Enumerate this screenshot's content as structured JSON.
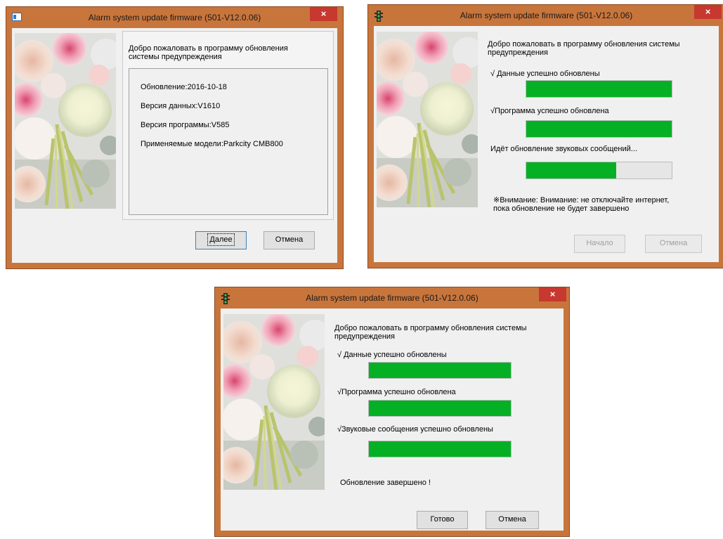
{
  "colors": {
    "progress": "#06b025",
    "titlebar": "#c8753c",
    "close": "#c7382f"
  },
  "window1": {
    "title": "Alarm system update firmware (501-V12.0.06)",
    "close_label": "×",
    "welcome": "Добро пожаловать в программу обновления системы предупреждения",
    "info": {
      "update": "Обновление:2016-10-18",
      "data_version": "Версия данных:V1610",
      "program_version": "Версия программы:V585",
      "models": "Применяемые модели:Parkcity CMB800"
    },
    "buttons": {
      "next": "Далее",
      "cancel": "Отмена"
    }
  },
  "window2": {
    "title": "Alarm system update firmware (501-V12.0.06)",
    "close_label": "×",
    "welcome": "Добро пожаловать в программу обновления системы предупреждения",
    "steps": [
      {
        "label": "√ Данные успешно обновлены",
        "progress": 1.0
      },
      {
        "label": "√Программа успешно обновлена",
        "progress": 1.0
      },
      {
        "label": "Идёт обновление звуковых сообщений...",
        "progress": 0.62
      }
    ],
    "warning": "※Внимание: Внимание: не отключайте интернет, пока обновление не будет завершено",
    "buttons": {
      "start": "Начало",
      "cancel": "Отмена"
    }
  },
  "window3": {
    "title": "Alarm system update firmware (501-V12.0.06)",
    "close_label": "×",
    "welcome": "Добро пожаловать в программу обновления системы предупреждения",
    "steps": [
      {
        "label": "√ Данные успешно обновлены",
        "progress": 1.0
      },
      {
        "label": "√Программа успешно обновлена",
        "progress": 1.0
      },
      {
        "label": "√Звуковые сообщения успешно обновлены",
        "progress": 1.0
      }
    ],
    "complete": "Обновление завершено !",
    "buttons": {
      "done": "Готово",
      "cancel": "Отмена"
    }
  }
}
